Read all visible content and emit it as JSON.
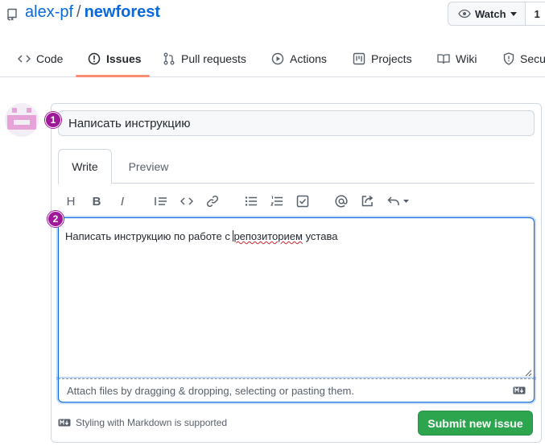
{
  "repo": {
    "owner": "alex-pf",
    "separator": "/",
    "name": "newforest",
    "watch_label": "Watch",
    "watch_count": "1"
  },
  "tabs": [
    {
      "label": "Code",
      "icon": "code-icon"
    },
    {
      "label": "Issues",
      "icon": "issue-icon",
      "active": true
    },
    {
      "label": "Pull requests",
      "icon": "pull-request-icon"
    },
    {
      "label": "Actions",
      "icon": "play-icon"
    },
    {
      "label": "Projects",
      "icon": "project-icon"
    },
    {
      "label": "Wiki",
      "icon": "book-icon"
    },
    {
      "label": "Secu",
      "icon": "shield-icon"
    }
  ],
  "issue": {
    "title_value": "Написать инструкцию",
    "editor_tabs": [
      "Write",
      "Preview"
    ],
    "body_before_caret": "Написать инструкцию по работе с ",
    "body_word_after_caret": "репозиторием",
    "body_after": " устава",
    "attach_hint": "Attach files by dragging & dropping, selecting or pasting them.",
    "markdown_note": "Styling with Markdown is supported",
    "submit_label": "Submit new issue"
  },
  "toolbar": [
    "heading-icon",
    "bold-icon",
    "italic-icon",
    "quote-icon",
    "code-icon",
    "link-icon",
    "bullet-list-icon",
    "numbered-list-icon",
    "task-list-icon",
    "mention-icon",
    "reference-icon",
    "reply-icon"
  ],
  "toolbar_text": {
    "heading": "H",
    "bold": "B",
    "italic": "I"
  },
  "badges": [
    "1",
    "2"
  ],
  "colors": {
    "link": "#0969da",
    "submit": "#2da44e",
    "active_tab_underline": "#fd8c73",
    "badge": "#a0189a",
    "avatar_pink": "#e6a3d8"
  }
}
